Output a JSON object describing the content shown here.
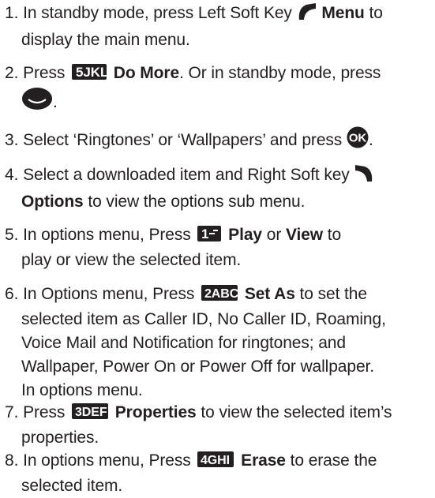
{
  "steps": [
    {
      "n": "1.",
      "a": "In standby mode, press Left Soft Key",
      "b": "Menu",
      "c": "to",
      "d": "display the main menu."
    },
    {
      "n": "2.",
      "a": "Press",
      "key": "5JKL",
      "b": "Do More",
      "c": ". Or in standby mode, press",
      "d": "."
    },
    {
      "n": "3.",
      "a": "Select ‘Ringtones’ or ‘Wallpapers’ and press",
      "ok": "OK",
      "d": "."
    },
    {
      "n": "4.",
      "a": "Select a downloaded item and Right Soft key",
      "b": "Options",
      "c": "to view the options sub menu."
    },
    {
      "n": "5.",
      "a": "In options menu, Press",
      "key": "1",
      "b": "Play",
      "c": "or",
      "b2": "View",
      "d": "to",
      "e": "play or view the selected item."
    },
    {
      "n": "6.",
      "a": "In Options menu, Press",
      "key": "2ABC",
      "b": "Set As",
      "c": "to set the",
      "l2": "selected item as Caller ID, No Caller ID, Roaming,",
      "l3": "Voice Mail and Notification for ringtones; and",
      "l4": "Wallpaper, Power On or Power Off for wallpaper.",
      "l5": "In options menu."
    },
    {
      "n": "7.",
      "a": "Press",
      "key": "3DEF",
      "b": "Properties",
      "c": "to view the selected item’s",
      "d": "properties."
    },
    {
      "n": "8.",
      "a": "In options menu, Press",
      "key": "4GHI",
      "b": "Erase",
      "c": "to erase the",
      "d": "selected item."
    }
  ]
}
